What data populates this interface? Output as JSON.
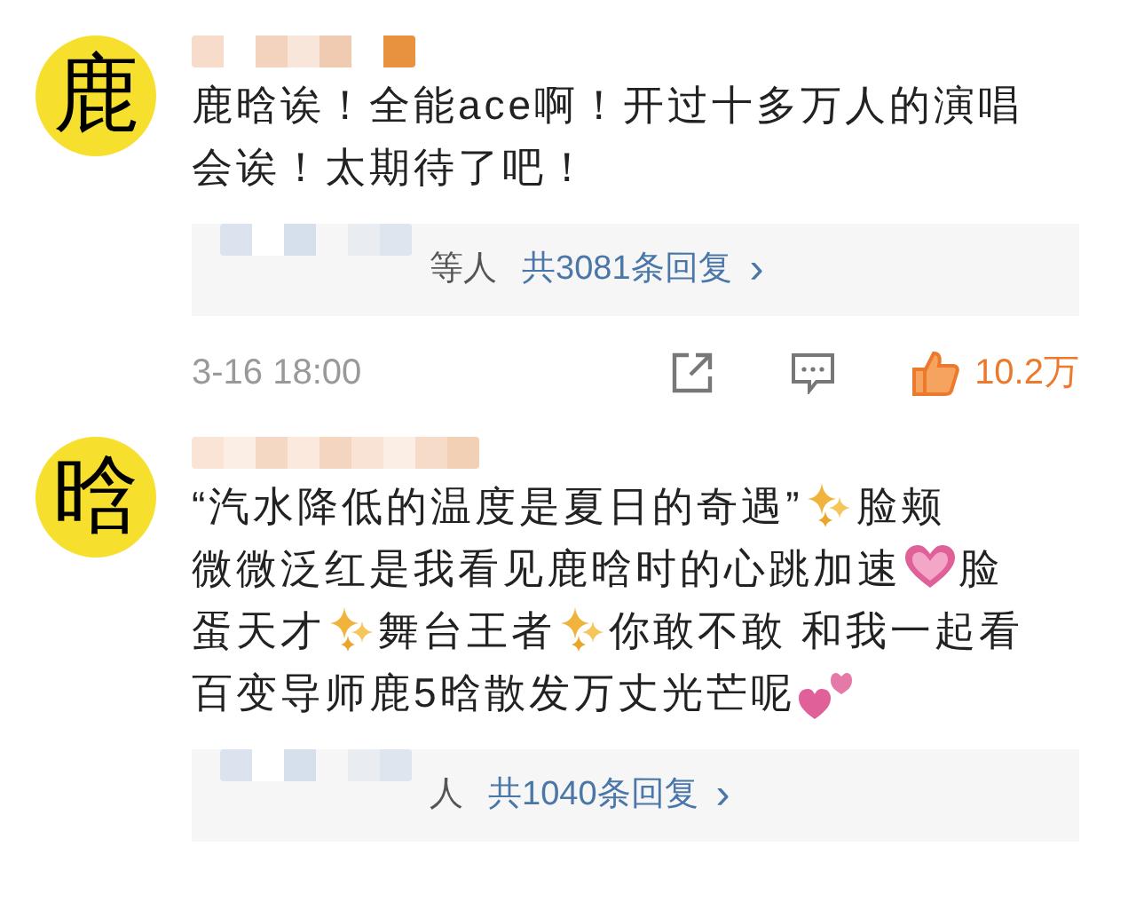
{
  "comments": [
    {
      "avatar_char": "鹿",
      "lines": [
        [
          {
            "kind": "text",
            "text": "鹿晗诶！全能ace啊！开过十多万人的演唱"
          }
        ],
        [
          {
            "kind": "text",
            "text": "会诶！太期待了吧！"
          }
        ]
      ],
      "replies": {
        "names": "等人",
        "count": "共3081条回复",
        "arrow": "›"
      },
      "footer": {
        "time": "3-16 18:00",
        "likes": "10.2万",
        "liked": true
      }
    },
    {
      "avatar_char": "晗",
      "lines": [
        [
          {
            "kind": "text",
            "text": "“汽水降低的温度是夏日的奇遇”"
          },
          {
            "kind": "sparkle"
          },
          {
            "kind": "text",
            "text": "脸颊"
          }
        ],
        [
          {
            "kind": "text",
            "text": "微微泛红是我看见鹿晗时的心跳加速"
          },
          {
            "kind": "heart"
          },
          {
            "kind": "text",
            "text": "脸"
          }
        ],
        [
          {
            "kind": "text",
            "text": "蛋天才"
          },
          {
            "kind": "sparkle"
          },
          {
            "kind": "text",
            "text": "舞台王者"
          },
          {
            "kind": "sparkle"
          },
          {
            "kind": "text",
            "text": "你敢不敢 和我一起看"
          }
        ],
        [
          {
            "kind": "text",
            "text": "百变导师鹿5晗散发万丈光芒呢"
          },
          {
            "kind": "hearts"
          }
        ]
      ],
      "replies": {
        "names": "人",
        "count": "共1040条回复",
        "arrow": "›"
      }
    }
  ]
}
